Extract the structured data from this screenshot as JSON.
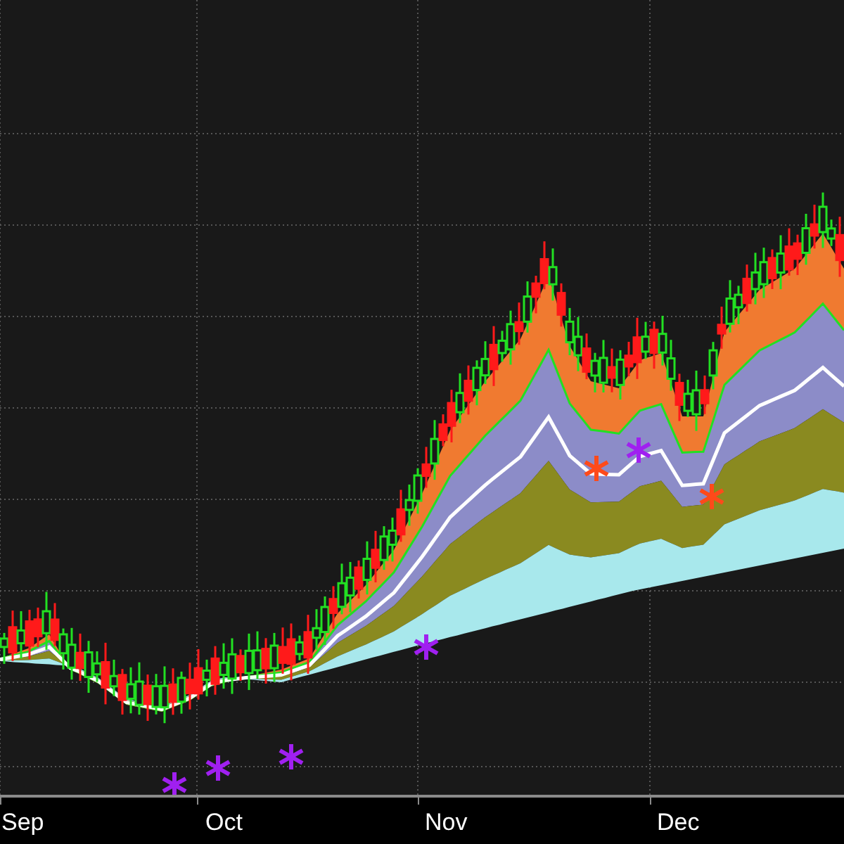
{
  "chart": {
    "x_axis_labels": [
      {
        "label": "Sep"
      },
      {
        "label": "Oct"
      },
      {
        "label": "Nov"
      },
      {
        "label": "Dec"
      }
    ]
  }
}
